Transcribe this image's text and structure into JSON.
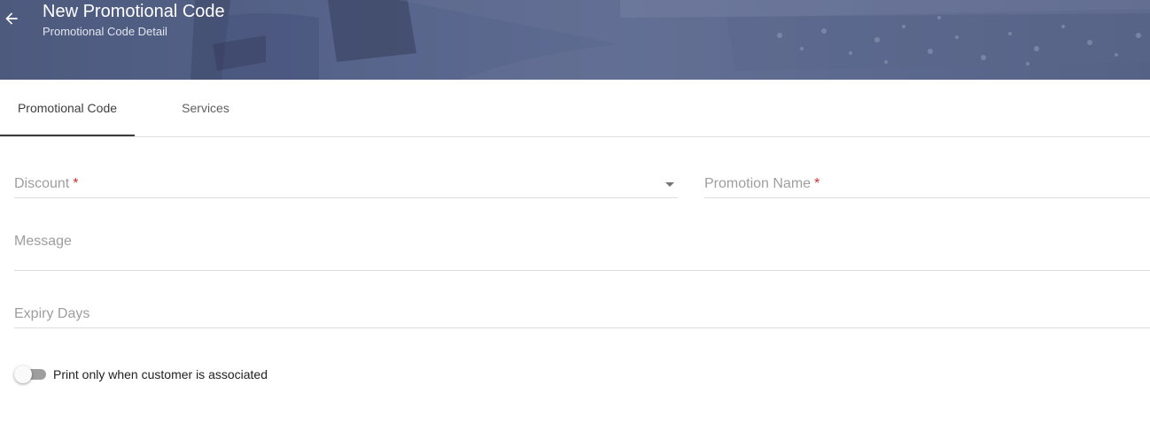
{
  "header": {
    "title": "New Promotional Code",
    "subtitle": "Promotional Code Detail"
  },
  "tabs": [
    {
      "label": "Promotional Code",
      "active": true
    },
    {
      "label": "Services",
      "active": false
    }
  ],
  "form": {
    "discount": {
      "label": "Discount",
      "required_mark": "*",
      "value": ""
    },
    "promotion_name": {
      "label": "Promotion Name",
      "required_mark": "*",
      "value": ""
    },
    "message": {
      "label": "Message",
      "value": ""
    },
    "expiry_days": {
      "label": "Expiry Days",
      "value": ""
    },
    "print_toggle": {
      "label": "Print only when customer is associated",
      "checked": false
    }
  },
  "colors": {
    "banner": "#56638a",
    "required": "#d32f2f",
    "tab_indicator": "#3a3a3a"
  }
}
